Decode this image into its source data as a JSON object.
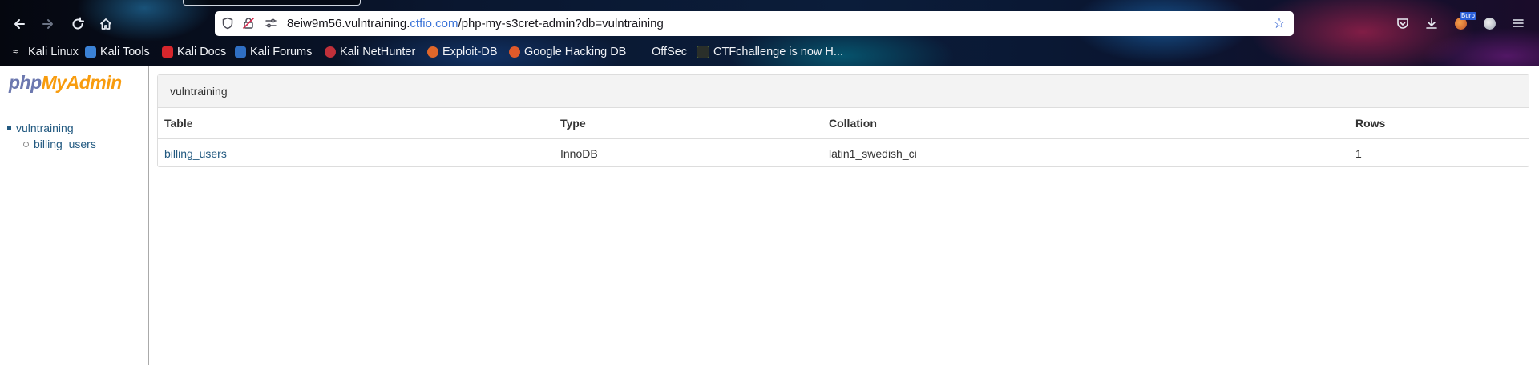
{
  "browser": {
    "url": {
      "host_prefix": "8eiw9m56.vulntraining.",
      "domain": "ctfio.com",
      "path": "/php-my-s3cret-admin?db=vulntraining"
    },
    "bookmarks": [
      {
        "label": "Kali Linux",
        "icon": "kali-dragon-icon"
      },
      {
        "label": "Kali Tools",
        "icon": "kali-tools-icon"
      },
      {
        "label": "Kali Docs",
        "icon": "kali-docs-icon"
      },
      {
        "label": "Kali Forums",
        "icon": "kali-forums-icon"
      },
      {
        "label": "Kali NetHunter",
        "icon": "nethunter-icon"
      },
      {
        "label": "Exploit-DB",
        "icon": "exploit-db-icon"
      },
      {
        "label": "Google Hacking DB",
        "icon": "ghdb-icon"
      },
      {
        "label": "OffSec",
        "icon": "offsec-icon"
      },
      {
        "label": "CTFchallenge is now H...",
        "icon": "ctf-icon"
      }
    ],
    "extension_badge": "Burp"
  },
  "sidebar": {
    "logo_php": "php",
    "logo_myadmin": "MyAdmin",
    "database": "vulntraining",
    "tables": [
      "billing_users"
    ]
  },
  "main": {
    "db_title": "vulntraining",
    "columns": [
      "Table",
      "Type",
      "Collation",
      "Rows"
    ],
    "rows": [
      {
        "table": "billing_users",
        "type": "InnoDB",
        "collation": "latin1_swedish_ci",
        "rows": "1"
      }
    ]
  },
  "colors": {
    "link": "#235a81",
    "logo_php": "#6c78af",
    "logo_myadmin": "#f89c0e",
    "url_domain": "#3b74d8"
  }
}
